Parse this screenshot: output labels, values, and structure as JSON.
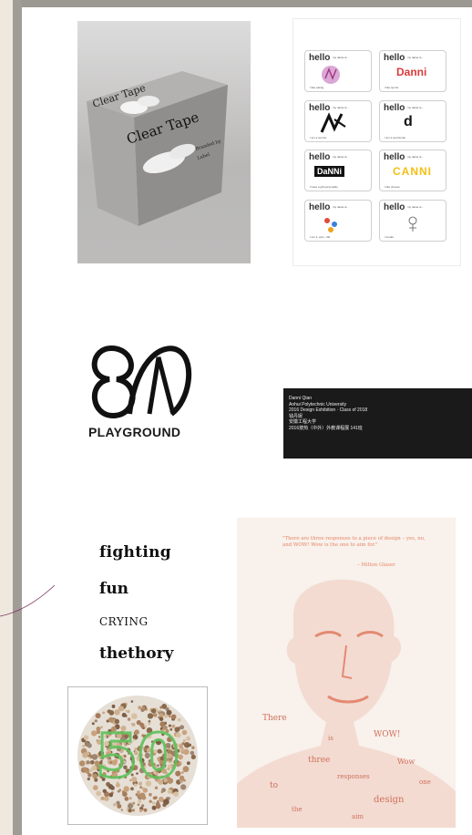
{
  "box": {
    "brand": "Clear Tape",
    "small_text_1": "Branded by",
    "small_text_2": "Label"
  },
  "badges": {
    "hello": "hello",
    "my_name_is": "my name is...",
    "items": [
      {
        "name": "",
        "tag": "I like eating"
      },
      {
        "name": "Danni",
        "tag": "I like sports"
      },
      {
        "name": "",
        "tag": "I am a sporter"
      },
      {
        "name": "d",
        "tag": "I am a sportsman"
      },
      {
        "name": "DaNNi",
        "tag": "I have a gift personality"
      },
      {
        "name": "CANNI",
        "tag": "I like cheese"
      },
      {
        "name": "",
        "tag": "I am 2, and, i did"
      },
      {
        "name": "",
        "tag": "I tunder"
      }
    ]
  },
  "logo": {
    "text": "PLAYGROUND"
  },
  "info": {
    "lines": [
      "Danni Qian",
      "Anhui Polytechnic University",
      "2016 Design Exhibition · Class of  2018",
      "钱丹妮",
      "安徽工程大学",
      "2016按热（中外）外教课程展 141班"
    ]
  },
  "typography": {
    "line1": "fighting",
    "line2": "fun",
    "line3": "CRYING",
    "line4": "thethory"
  },
  "poster": {
    "quote": "\"There are three responses to a piece of design – yes, no, and WOW! Wow is the one to aim for.\"",
    "author": "– Milton Glaser",
    "words": [
      "There",
      "WOW!",
      "three",
      "design",
      "to",
      "responses",
      "Wow",
      "is",
      "the",
      "one",
      "aim"
    ]
  },
  "ishihara": {
    "number": "50"
  },
  "colors": {
    "frame": "#9b9791",
    "background": "#efe8df",
    "quote": "#e88566",
    "ishi_green": "#5ec25a"
  }
}
